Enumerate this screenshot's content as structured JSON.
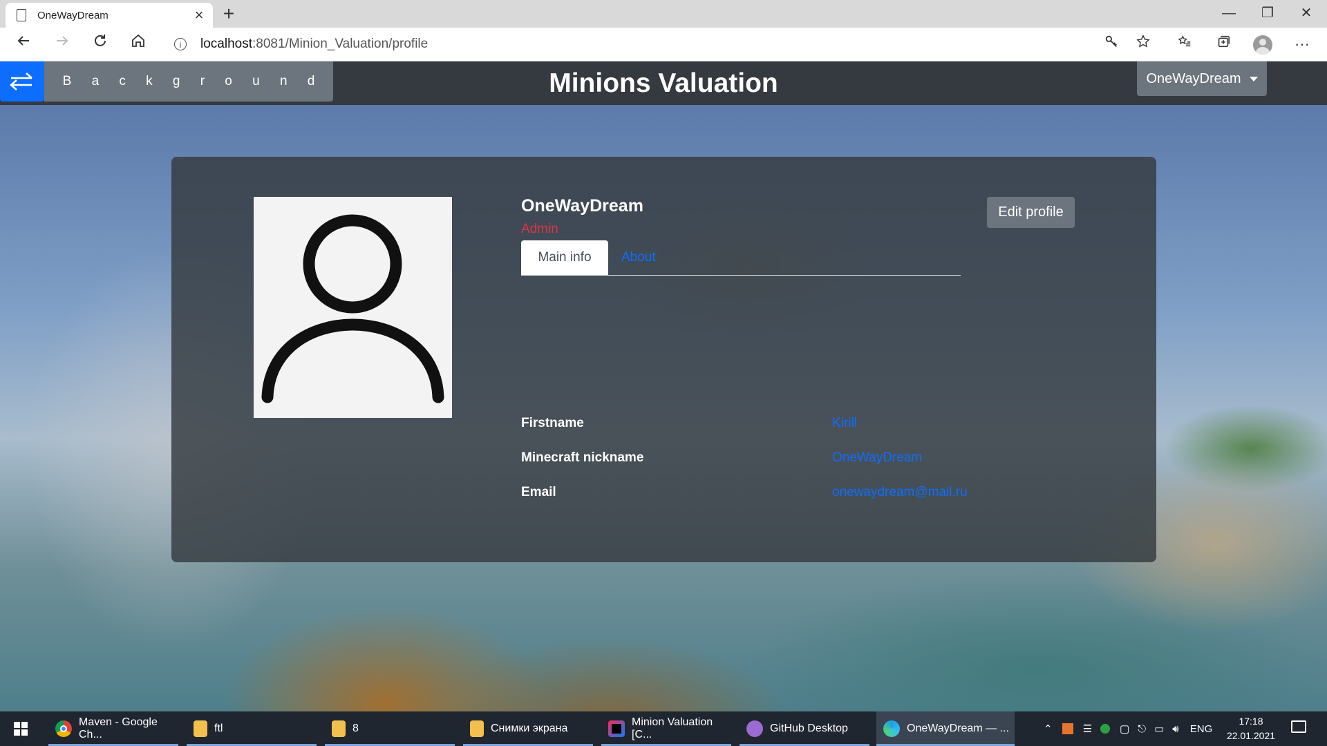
{
  "browser": {
    "tab_title": "OneWayDream",
    "url_host": "localhost",
    "url_path": ":8081/Minion_Valuation/profile",
    "controls": {
      "minimize": "—",
      "maximize": "❐",
      "close": "✕",
      "new_tab": "+",
      "tab_close": "×"
    },
    "icons": [
      "back-icon",
      "forward-icon",
      "reload-icon",
      "home-icon",
      "info-icon",
      "key-icon",
      "star-icon",
      "favorites-icon",
      "collections-icon",
      "profile-icon",
      "more-icon"
    ]
  },
  "navbar": {
    "background_toggle_letters": [
      "B",
      "a",
      "c",
      "k",
      "g",
      "r",
      "o",
      "u",
      "n",
      "d"
    ],
    "brand": "Minions Valuation",
    "user_menu": "OneWayDream"
  },
  "profile": {
    "username": "OneWayDream",
    "role": "Admin",
    "edit_button": "Edit profile",
    "tabs": [
      "Main info",
      "About"
    ],
    "active_tab": "Main info",
    "fields": [
      {
        "label": "Firstname",
        "value": "Kirill"
      },
      {
        "label": "Minecraft nickname",
        "value": "OneWayDream"
      },
      {
        "label": "Email",
        "value": "onewaydream@mail.ru"
      }
    ]
  },
  "taskbar": {
    "items": [
      {
        "label": "Maven - Google Ch...",
        "icon": "chrome-icon"
      },
      {
        "label": "ftl",
        "icon": "folder-icon"
      },
      {
        "label": "8",
        "icon": "folder-icon"
      },
      {
        "label": "Снимки экрана",
        "icon": "folder-icon"
      },
      {
        "label": "Minion Valuation [C...",
        "icon": "intellij-icon"
      },
      {
        "label": "GitHub Desktop",
        "icon": "github-icon"
      },
      {
        "label": "OneWayDream — ...",
        "icon": "edge-icon"
      }
    ],
    "language": "ENG",
    "time": "17:18",
    "date": "22.01.2021"
  },
  "colors": {
    "navbar": "#343a40",
    "primary": "#0d6efd",
    "secondary": "#6c757d",
    "danger": "#dc3545"
  }
}
